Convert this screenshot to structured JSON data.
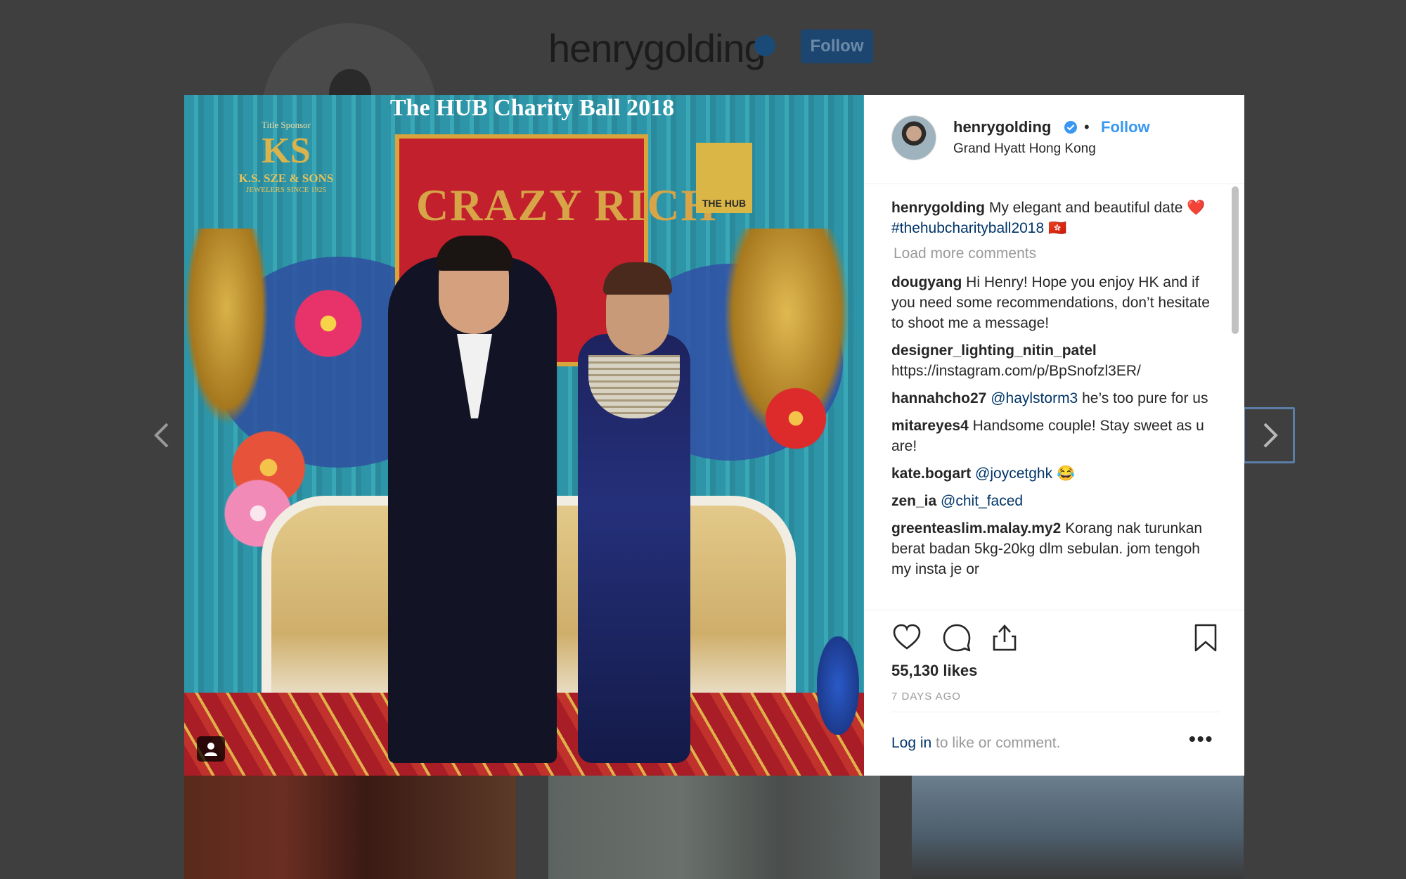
{
  "background": {
    "username": "henrygolding",
    "follow_label": "Follow"
  },
  "photo": {
    "event_title": "The HUB Charity Ball 2018",
    "sponsor_caption": "Title Sponsor",
    "sponsor_logo": "KS",
    "sponsor_name": "K.S. SZE & SONS",
    "sponsor_sub": "JEWELERS SINCE 1925",
    "hub_logo": "THE HUB",
    "board_text": "CRAZY RICH"
  },
  "post": {
    "username": "henrygolding",
    "dot": "•",
    "follow_label": "Follow",
    "location": "Grand Hyatt Hong Kong",
    "caption_user": "henrygolding",
    "caption_text": "My elegant and beautiful date ❤️",
    "caption_tag": "#thehubcharityball2018",
    "caption_flag": "🇭🇰",
    "load_more": "Load more comments",
    "comments": [
      {
        "user": "dougyang",
        "mention": "",
        "text": "Hi Henry! Hope you enjoy HK and if you need some recommendations, don’t hesitate to shoot me a message!"
      },
      {
        "user": "designer_lighting_nitin_patel",
        "mention": "",
        "text": "https://instagram.com/p/BpSnofzl3ER/"
      },
      {
        "user": "hannahcho27",
        "mention": "@haylstorm3",
        "text": "he’s too pure for us"
      },
      {
        "user": "mitareyes4",
        "mention": "",
        "text": "Handsome couple! Stay sweet as u are!"
      },
      {
        "user": "kate.bogart",
        "mention": "@joycetghk",
        "text": "😂"
      },
      {
        "user": "zen_ia",
        "mention": "@chit_faced",
        "text": ""
      },
      {
        "user": "greenteaslim.malay.my2",
        "mention": "",
        "text": "Korang nak turunkan berat badan 5kg-20kg dlm sebulan. jom tengoh my insta je or"
      }
    ],
    "likes": "55,130 likes",
    "time": "7 DAYS AGO",
    "login_link": "Log in",
    "login_rest": " to like or comment.",
    "more": "•••"
  }
}
